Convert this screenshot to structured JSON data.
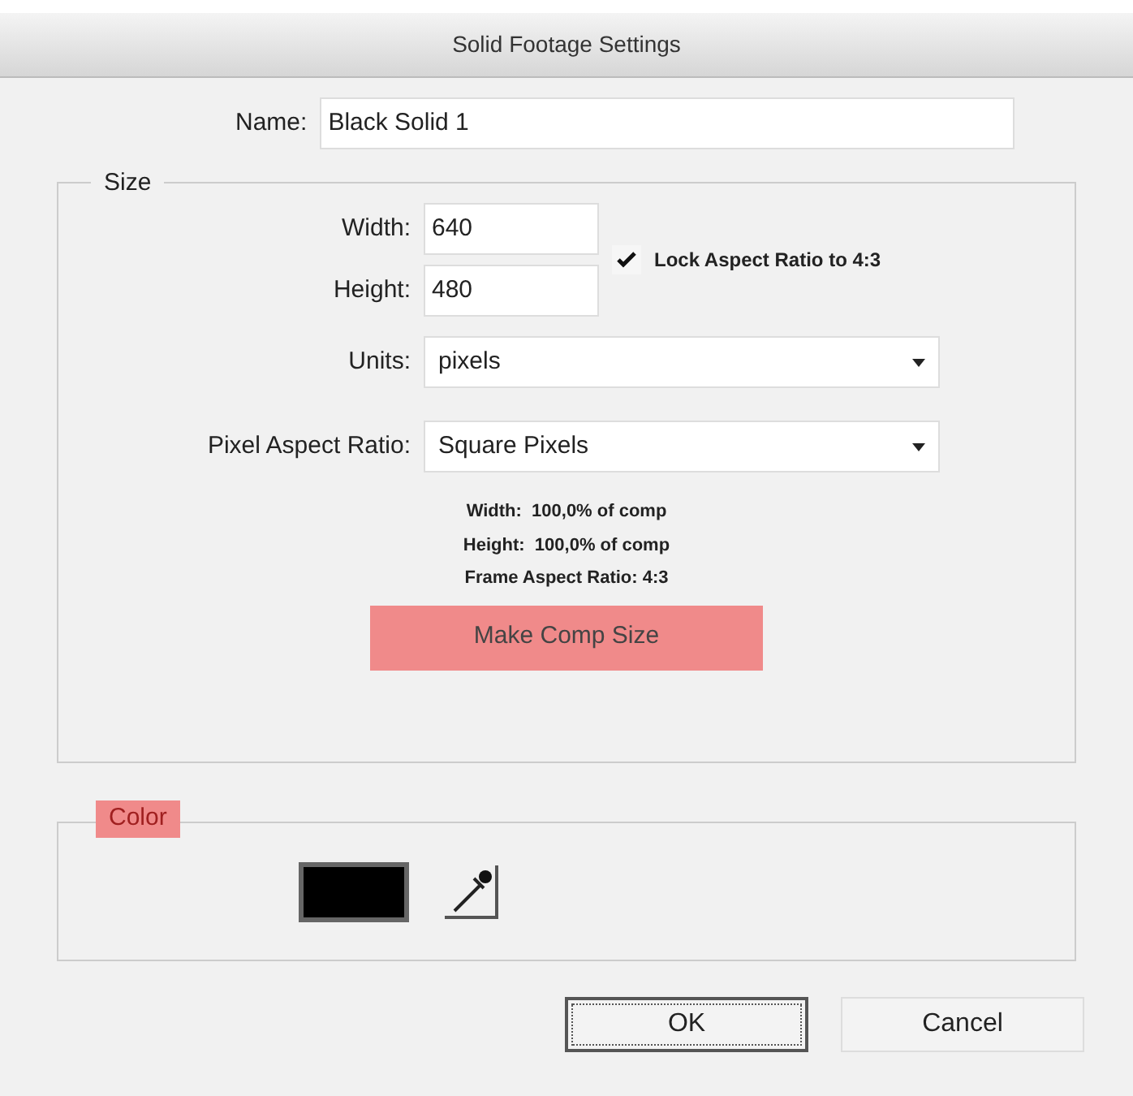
{
  "window": {
    "title": "Solid Footage Settings"
  },
  "name": {
    "label": "Name:",
    "value": "Black Solid 1"
  },
  "size": {
    "legend": "Size",
    "width": {
      "label": "Width:",
      "value": "640"
    },
    "height": {
      "label": "Height:",
      "value": "480"
    },
    "lock": {
      "label": "Lock Aspect Ratio to 4:3",
      "checked": true
    },
    "units": {
      "label": "Units:",
      "value": "pixels"
    },
    "pixel_aspect": {
      "label": "Pixel Aspect Ratio:",
      "value": "Square Pixels"
    },
    "info": [
      "Width:  100,0% of comp",
      "Height:  100,0% of comp",
      "Frame Aspect Ratio: 4:3"
    ],
    "make_comp_size": {
      "label": "Make Comp Size",
      "highlighted": true
    }
  },
  "color": {
    "legend": "Color",
    "highlighted": true,
    "swatch": {
      "color": "#000000"
    }
  },
  "buttons": [
    {
      "label": "OK",
      "default": true
    },
    {
      "label": "Cancel",
      "default": false
    }
  ]
}
